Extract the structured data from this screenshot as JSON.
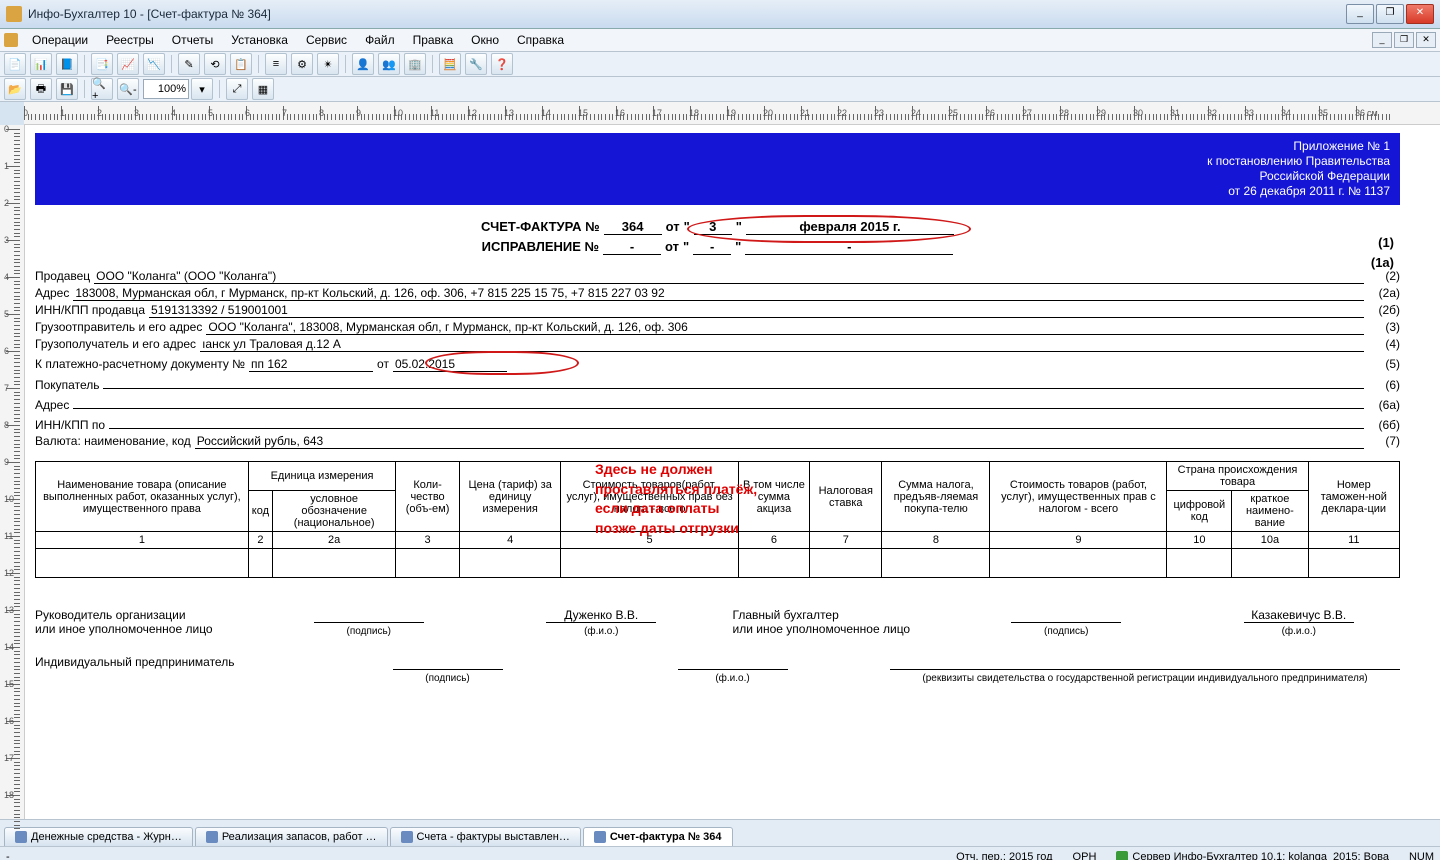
{
  "window": {
    "title": "Инфо-Бухгалтер 10 - [Счет-фактура № 364]"
  },
  "menu": [
    "Операции",
    "Реестры",
    "Отчеты",
    "Установка",
    "Сервис",
    "Файл",
    "Правка",
    "Окно",
    "Справка"
  ],
  "zoom": "100%",
  "appendix": {
    "l1": "Приложение № 1",
    "l2": "к постановлению Правительства",
    "l3": "Российской Федерации",
    "l4": "от 26 декабря 2011 г. № 1137"
  },
  "hdr": {
    "sf_label": "СЧЕТ-ФАКТУРА №",
    "sf_no": "364",
    "ot": "от",
    "q1": "\"",
    "day": "3",
    "q2": "\"",
    "month_year": "февраля 2015 г.",
    "num1": "(1)",
    "corr_label": "ИСПРАВЛЕНИЕ №",
    "corr_no": "-",
    "corr_day": "-",
    "corr_month": "-",
    "num1a": "(1а)"
  },
  "fields": {
    "seller_l": "Продавец",
    "seller_v": "ООО \"Коланга\" (ООО \"Коланга\")",
    "seller_n": "(2)",
    "addr_l": "Адрес",
    "addr_v": "183008, Мурманская обл, г Мурманск, пр-кт Кольский, д. 126, оф. 306, +7 815 225 15 75, +7 815 227 03 92",
    "addr_n": "(2а)",
    "inn_l": "ИНН/КПП продавца",
    "inn_v": "5191313392 / 519001001",
    "inn_n": "(2б)",
    "shipper_l": "Грузоотправитель и его адрес",
    "shipper_v": "ООО \"Коланга\", 183008, Мурманская обл, г Мурманск, пр-кт Кольский, д. 126, оф. 306",
    "shipper_n": "(3)",
    "consignee_l": "Грузополучатель и его адрес",
    "consignee_v": "ıанск ул Траловая д.12 А",
    "consignee_n": "(4)",
    "paydoc_l": "К платежно-расчетному документу №",
    "paydoc_no": "пп 162",
    "paydoc_ot": "от",
    "paydoc_date": "05.02.2015",
    "paydoc_n": "(5)",
    "buyer_l": "Покупатель",
    "buyer_v": "",
    "buyer_n": "(6)",
    "baddr_l": "Адрес",
    "baddr_v": "",
    "baddr_n": "(6а)",
    "binn_l": "ИНН/КПП по",
    "binn_v": "",
    "binn_n": "(6б)",
    "curr_l": "Валюта: наименование, код",
    "curr_v": "Российский рубль, 643",
    "curr_n": "(7)"
  },
  "annot": {
    "l1": "Здесь не должен",
    "l2": "проставляться платёж,",
    "l3": "если дата оплаты",
    "l4": "позже даты отгрузки"
  },
  "thead": {
    "c1": "Наименование товара (описание выполненных работ, оказанных услуг), имущественного права",
    "c2g": "Единица измерения",
    "c2a": "код",
    "c2b": "условное обозначение (национальное)",
    "c3": "Коли-чество (объ-ем)",
    "c4": "Цена (тариф) за единицу измерения",
    "c5": "Стоимость товаров(работ, услуг), имущественных прав без налога - всего",
    "c6": "В том числе сумма акциза",
    "c7": "Налоговая ставка",
    "c8": "Сумма налога, предъяв-ляемая покупа-телю",
    "c9": "Стоимость товаров (работ, услуг), имущественных прав с налогом - всего",
    "c10g": "Страна происхождения товара",
    "c10a": "цифровой код",
    "c10b": "краткое наимено-вание",
    "c11": "Номер таможен-ной деклара-ции"
  },
  "colnums": [
    "1",
    "2",
    "2а",
    "3",
    "4",
    "5",
    "6",
    "7",
    "8",
    "9",
    "10",
    "10а",
    "11"
  ],
  "sign": {
    "head_l": "Руководитель организации\nили иное уполномоченное лицо",
    "head_name": "Дуженко В.В.",
    "acc_l": "Главный бухгалтер\nили иное уполномоченное лицо",
    "acc_name": "Казакевичус В.В.",
    "ip_l": "Индивидуальный предприниматель",
    "podpis": "(подпись)",
    "fio": "(ф.и.о.)",
    "ip_note": "(реквизиты свидетельства о государственной регистрации индивидуального предпринимателя)"
  },
  "tabs": [
    {
      "label": "Денежные средства - Журн…",
      "active": false
    },
    {
      "label": "Реализация запасов, работ …",
      "active": false
    },
    {
      "label": "Счета - фактуры выставлен…",
      "active": false
    },
    {
      "label": "Счет-фактура № 364",
      "active": true
    }
  ],
  "status": {
    "dash": "-",
    "period": "Отч. пер.: 2015 год",
    "orn": "ОРН",
    "server": "Сервер Инфо-Бухгалтер 10.1: kolanga_2015: Вова",
    "num": "NUM"
  }
}
